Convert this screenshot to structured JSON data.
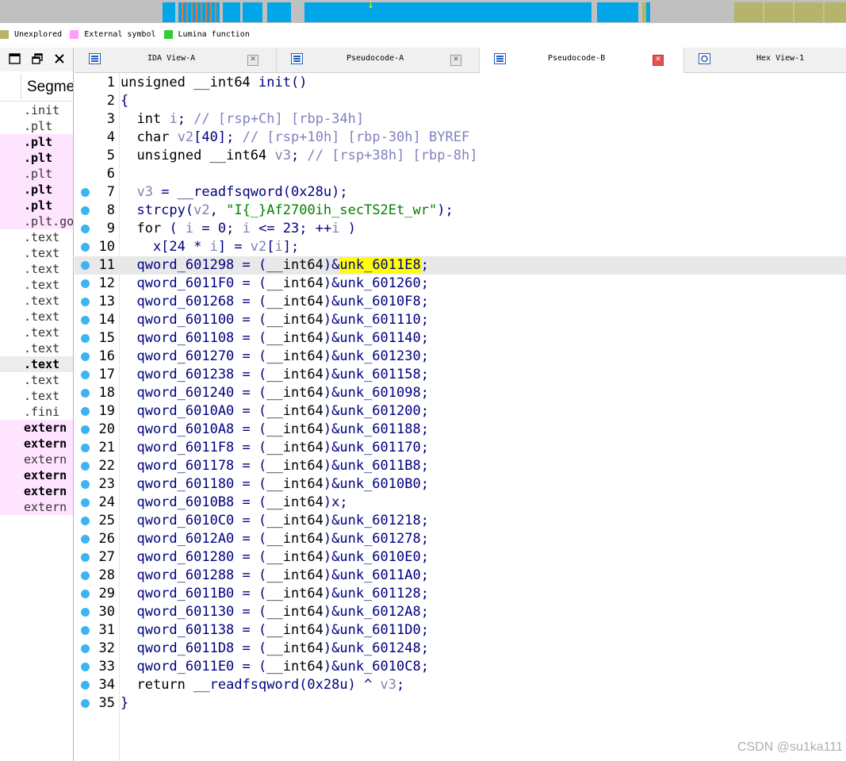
{
  "navbar": {
    "segments_colors": {
      "blue": "#00a6e8",
      "olive": "#b5b46a",
      "orange": "#e07840",
      "gray": "#c0c0c0"
    }
  },
  "legend": [
    {
      "label": "Unexplored",
      "color": "#b5b46a"
    },
    {
      "label": "External symbol",
      "color": "#ff9cff"
    },
    {
      "label": "Lumina function",
      "color": "#33cc33"
    }
  ],
  "left_panel": {
    "header": "Segme",
    "rows": [
      {
        "text": ".init",
        "style": "normal"
      },
      {
        "text": ".plt",
        "style": "normal"
      },
      {
        "text": ".plt",
        "style": "pink-bold"
      },
      {
        "text": ".plt",
        "style": "pink-bold"
      },
      {
        "text": ".plt",
        "style": "pink"
      },
      {
        "text": ".plt",
        "style": "pink-bold"
      },
      {
        "text": ".plt",
        "style": "pink-bold"
      },
      {
        "text": ".plt.go",
        "style": "pink"
      },
      {
        "text": ".text",
        "style": "normal"
      },
      {
        "text": ".text",
        "style": "normal"
      },
      {
        "text": ".text",
        "style": "normal"
      },
      {
        "text": ".text",
        "style": "normal"
      },
      {
        "text": ".text",
        "style": "normal"
      },
      {
        "text": ".text",
        "style": "normal"
      },
      {
        "text": ".text",
        "style": "normal"
      },
      {
        "text": ".text",
        "style": "normal"
      },
      {
        "text": ".text",
        "style": "selected"
      },
      {
        "text": ".text",
        "style": "normal"
      },
      {
        "text": ".text",
        "style": "normal"
      },
      {
        "text": ".fini",
        "style": "normal"
      },
      {
        "text": "extern",
        "style": "pink-bold"
      },
      {
        "text": "extern",
        "style": "pink-bold"
      },
      {
        "text": "extern",
        "style": "pink"
      },
      {
        "text": "extern",
        "style": "pink-bold"
      },
      {
        "text": "extern",
        "style": "pink-bold"
      },
      {
        "text": "extern",
        "style": "pink"
      }
    ]
  },
  "tabs": [
    {
      "label": "IDA View-A",
      "active": false,
      "close": "gray"
    },
    {
      "label": "Pseudocode-A",
      "active": false,
      "close": "gray"
    },
    {
      "label": "Pseudocode-B",
      "active": true,
      "close": "red"
    },
    {
      "label": "Hex View-1",
      "active": false,
      "close": "none"
    }
  ],
  "code": {
    "current_line": 11,
    "highlight_token": "unk_6011E8",
    "lines": [
      {
        "n": "1",
        "bp": false,
        "text": "unsigned __int64 init()"
      },
      {
        "n": "2",
        "bp": false,
        "text": "{"
      },
      {
        "n": "3",
        "bp": false,
        "text": "  int i; // [rsp+Ch] [rbp-34h]"
      },
      {
        "n": "4",
        "bp": false,
        "text": "  char v2[40]; // [rsp+10h] [rbp-30h] BYREF"
      },
      {
        "n": "5",
        "bp": false,
        "text": "  unsigned __int64 v3; // [rsp+38h] [rbp-8h]"
      },
      {
        "n": "6",
        "bp": false,
        "text": ""
      },
      {
        "n": "7",
        "bp": true,
        "text": "  v3 = __readfsqword(0x28u);"
      },
      {
        "n": "8",
        "bp": true,
        "text": "  strcpy(v2, \"I{_}Af2700ih_secTS2Et_wr\");"
      },
      {
        "n": "9",
        "bp": true,
        "text": "  for ( i = 0; i <= 23; ++i )"
      },
      {
        "n": "10",
        "bp": true,
        "text": "    x[24 * i] = v2[i];"
      },
      {
        "n": "11",
        "bp": true,
        "text": "  qword_601298 = (__int64)&unk_6011E8;"
      },
      {
        "n": "12",
        "bp": true,
        "text": "  qword_6011F0 = (__int64)&unk_601260;"
      },
      {
        "n": "13",
        "bp": true,
        "text": "  qword_601268 = (__int64)&unk_6010F8;"
      },
      {
        "n": "14",
        "bp": true,
        "text": "  qword_601100 = (__int64)&unk_601110;"
      },
      {
        "n": "15",
        "bp": true,
        "text": "  qword_601108 = (__int64)&unk_601140;"
      },
      {
        "n": "16",
        "bp": true,
        "text": "  qword_601270 = (__int64)&unk_601230;"
      },
      {
        "n": "17",
        "bp": true,
        "text": "  qword_601238 = (__int64)&unk_601158;"
      },
      {
        "n": "18",
        "bp": true,
        "text": "  qword_601240 = (__int64)&unk_601098;"
      },
      {
        "n": "19",
        "bp": true,
        "text": "  qword_6010A0 = (__int64)&unk_601200;"
      },
      {
        "n": "20",
        "bp": true,
        "text": "  qword_6010A8 = (__int64)&unk_601188;"
      },
      {
        "n": "21",
        "bp": true,
        "text": "  qword_6011F8 = (__int64)&unk_601170;"
      },
      {
        "n": "22",
        "bp": true,
        "text": "  qword_601178 = (__int64)&unk_6011B8;"
      },
      {
        "n": "23",
        "bp": true,
        "text": "  qword_601180 = (__int64)&unk_6010B0;"
      },
      {
        "n": "24",
        "bp": true,
        "text": "  qword_6010B8 = (__int64)x;"
      },
      {
        "n": "25",
        "bp": true,
        "text": "  qword_6010C0 = (__int64)&unk_601218;"
      },
      {
        "n": "26",
        "bp": true,
        "text": "  qword_6012A0 = (__int64)&unk_601278;"
      },
      {
        "n": "27",
        "bp": true,
        "text": "  qword_601280 = (__int64)&unk_6010E0;"
      },
      {
        "n": "28",
        "bp": true,
        "text": "  qword_601288 = (__int64)&unk_6011A0;"
      },
      {
        "n": "29",
        "bp": true,
        "text": "  qword_6011B0 = (__int64)&unk_601128;"
      },
      {
        "n": "30",
        "bp": true,
        "text": "  qword_601130 = (__int64)&unk_6012A8;"
      },
      {
        "n": "31",
        "bp": true,
        "text": "  qword_601138 = (__int64)&unk_6011D0;"
      },
      {
        "n": "32",
        "bp": true,
        "text": "  qword_6011D8 = (__int64)&unk_601248;"
      },
      {
        "n": "33",
        "bp": true,
        "text": "  qword_6011E0 = (__int64)&unk_6010C8;"
      },
      {
        "n": "34",
        "bp": true,
        "text": "  return __readfsqword(0x28u) ^ v3;"
      },
      {
        "n": "35",
        "bp": true,
        "text": "}"
      }
    ]
  },
  "watermark": "CSDN @su1ka111"
}
